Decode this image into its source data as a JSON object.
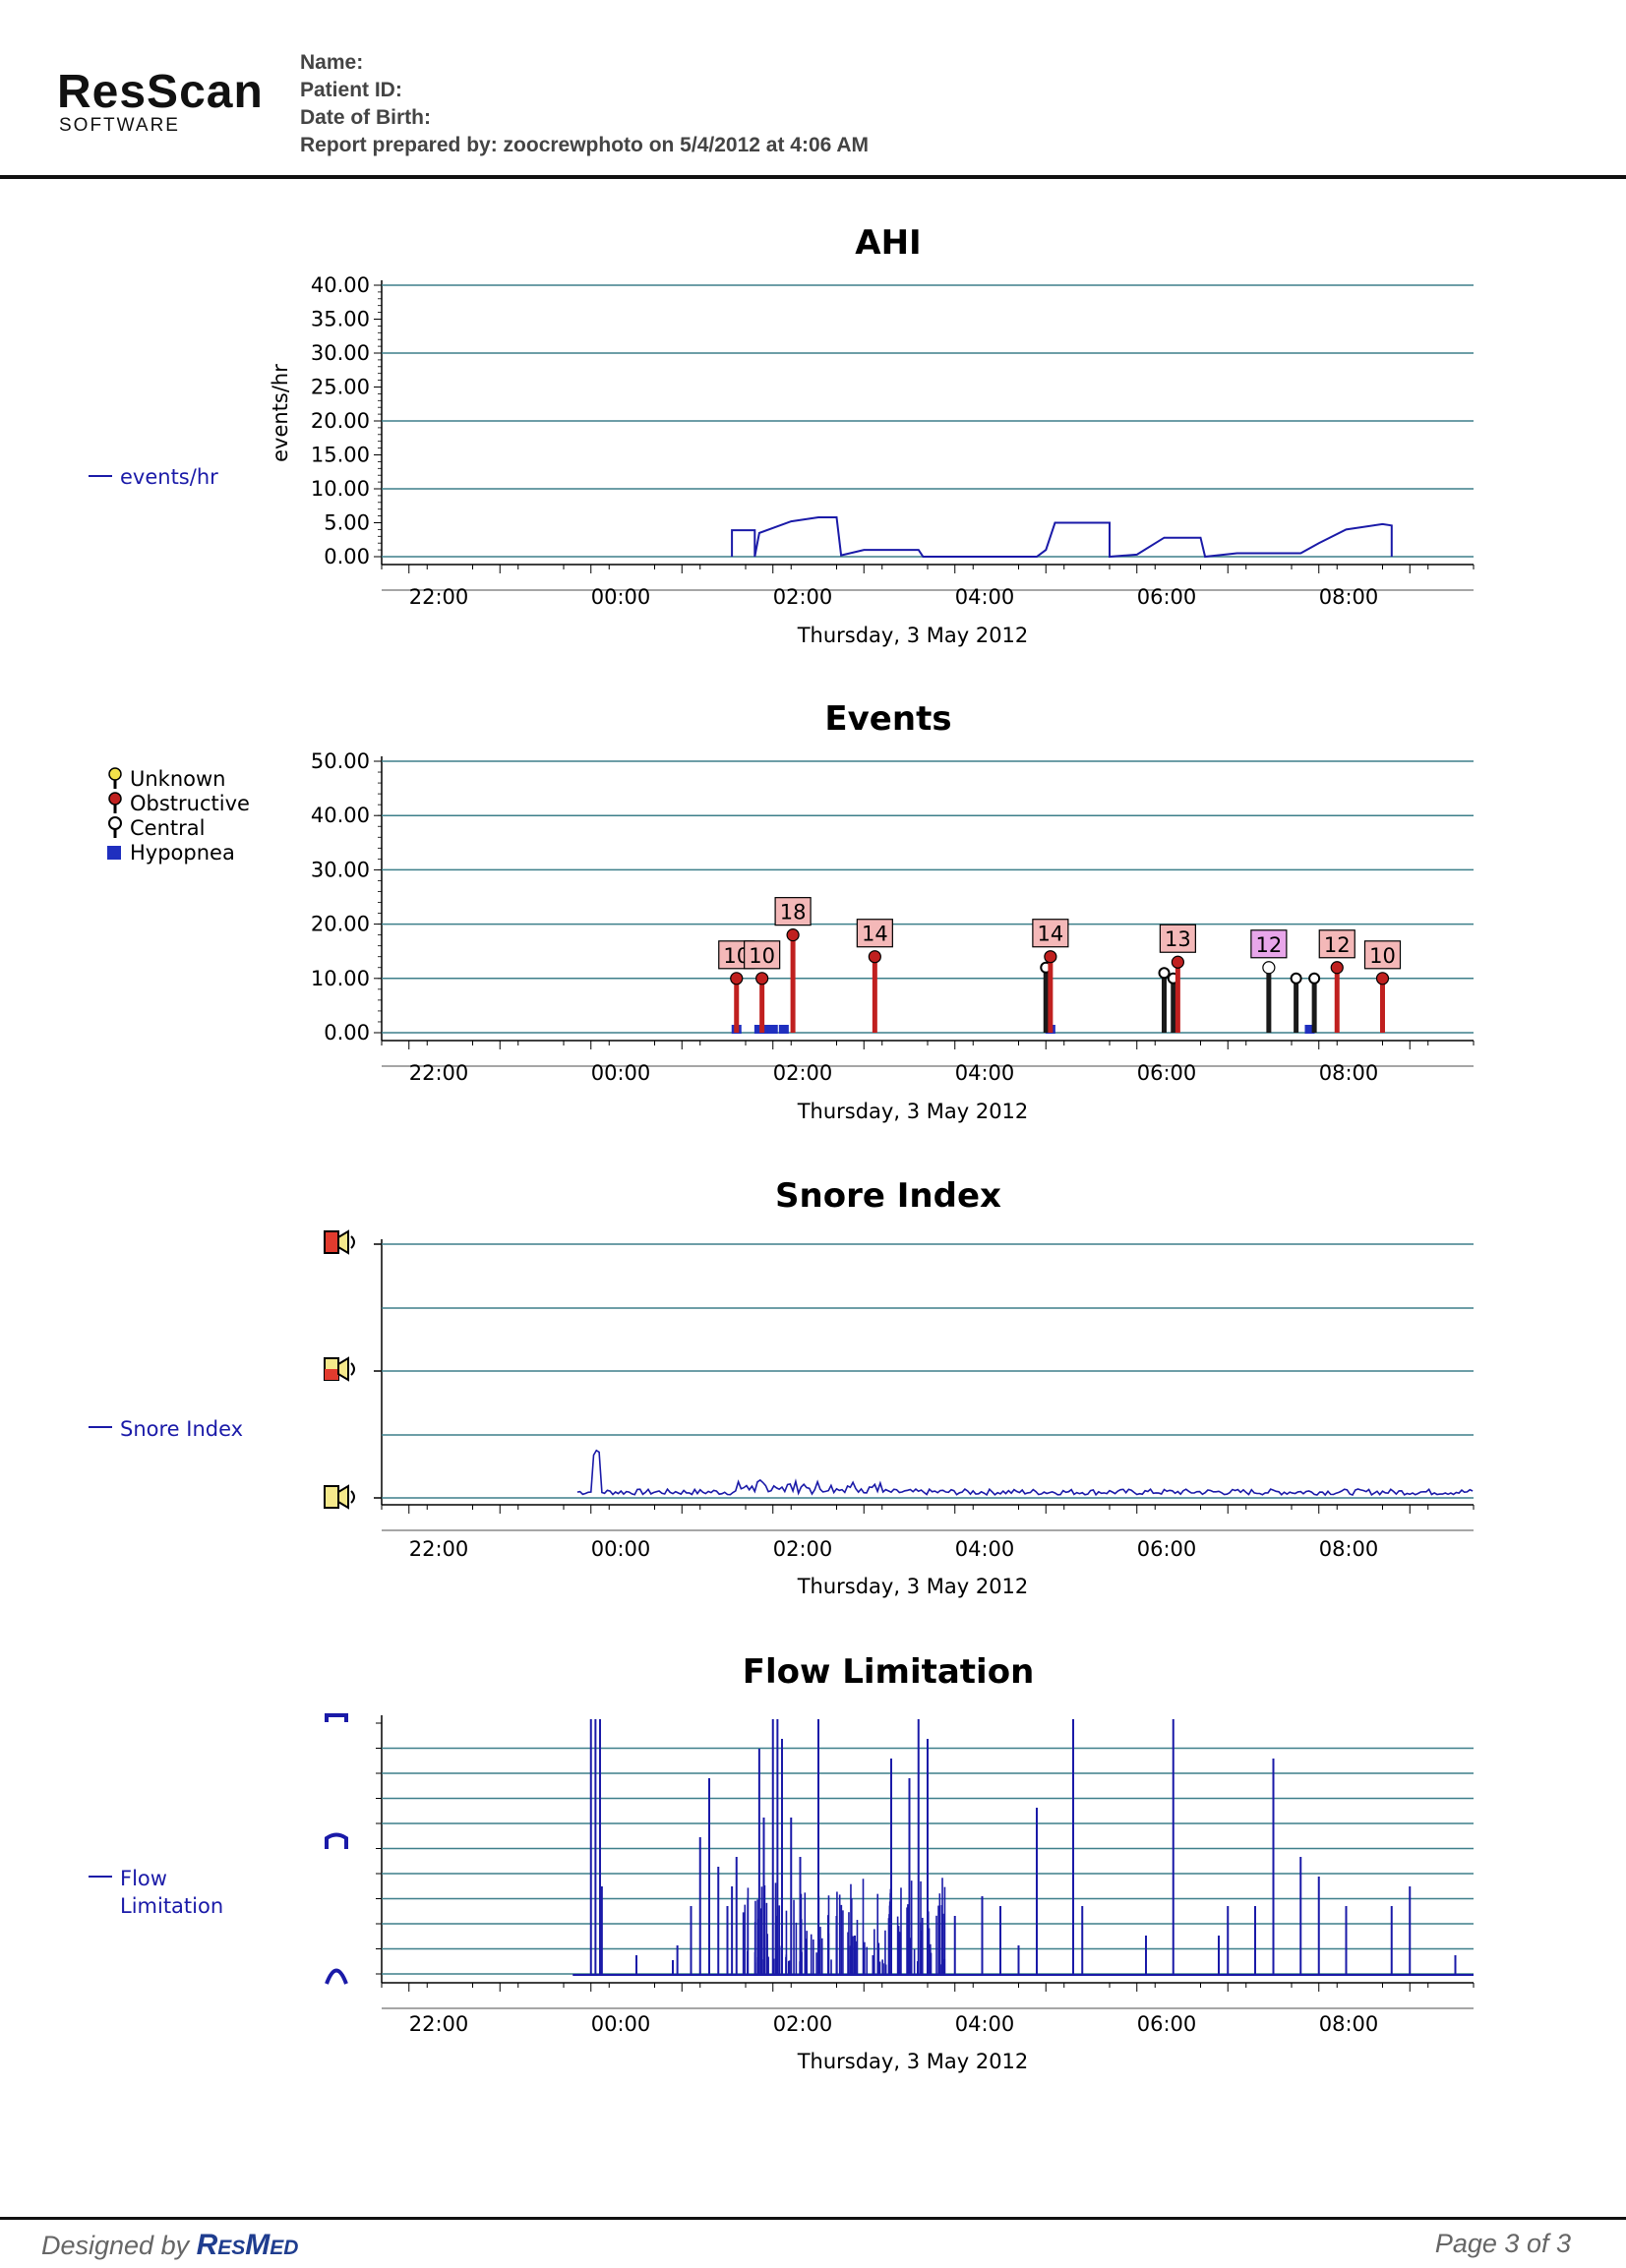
{
  "header": {
    "logo_main": "ResScan",
    "logo_sub": "SOFTWARE",
    "name_label": "Name:",
    "patient_id_label": "Patient ID:",
    "dob_label": "Date of Birth:",
    "prepared_by": "Report prepared by: zoocrewphoto on 5/4/2012 at 4:06 AM"
  },
  "footer": {
    "designed_by": "Designed by",
    "brand": "ResMed",
    "page": "Page 3 of 3"
  },
  "colors": {
    "line": "#1a1aa8",
    "grid": "#3d7f8a",
    "obstructive": "#c0201f",
    "central": "#1a1a1a",
    "hypopnea": "#1f2fbf",
    "label_pink": "#f4b8b8",
    "label_violet": "#e8a6ea"
  },
  "chart_data": [
    {
      "type": "line",
      "title": "AHI",
      "ylabel": "events/hr",
      "xlabel": "Thursday, 3 May 2012",
      "x_ticks": [
        "22:00",
        "00:00",
        "02:00",
        "04:00",
        "06:00",
        "08:00"
      ],
      "y_ticks": [
        "0.00",
        "5.00",
        "10.00",
        "15.00",
        "20.00",
        "25.00",
        "30.00",
        "35.00",
        "40.00"
      ],
      "ylim": [
        0,
        40
      ],
      "grid": true,
      "legend": [
        {
          "name": "events/hr",
          "position": "left"
        }
      ],
      "series": [
        {
          "name": "events/hr",
          "points": [
            [
              1.55,
              0
            ],
            [
              1.55,
              3.9
            ],
            [
              1.8,
              3.9
            ],
            [
              1.8,
              0
            ],
            [
              1.85,
              3.5
            ],
            [
              2.2,
              5.2
            ],
            [
              2.5,
              5.8
            ],
            [
              2.7,
              5.8
            ],
            [
              2.75,
              0.2
            ],
            [
              3.0,
              1.0
            ],
            [
              3.6,
              1.0
            ],
            [
              3.65,
              0
            ],
            [
              4.9,
              0
            ],
            [
              5.0,
              1.0
            ],
            [
              5.1,
              5.0
            ],
            [
              5.7,
              5.0
            ],
            [
              5.7,
              0
            ],
            [
              6.0,
              0.3
            ],
            [
              6.3,
              2.8
            ],
            [
              6.7,
              2.8
            ],
            [
              6.75,
              0
            ],
            [
              7.1,
              0.5
            ],
            [
              7.5,
              0.5
            ],
            [
              7.8,
              0.5
            ],
            [
              8.0,
              2.0
            ],
            [
              8.3,
              4.0
            ],
            [
              8.7,
              4.8
            ],
            [
              8.8,
              4.6
            ],
            [
              8.8,
              0
            ]
          ]
        }
      ]
    },
    {
      "type": "scatter",
      "title": "Events",
      "xlabel": "Thursday, 3 May 2012",
      "x_ticks": [
        "22:00",
        "00:00",
        "02:00",
        "04:00",
        "06:00",
        "08:00"
      ],
      "y_ticks": [
        "0.00",
        "10.00",
        "20.00",
        "30.00",
        "40.00",
        "50.00"
      ],
      "ylim": [
        0,
        50
      ],
      "grid": true,
      "legend": [
        "Unknown",
        "Obstructive",
        "Central",
        "Hypopnea"
      ],
      "events": [
        {
          "t": 1.6,
          "v": 10,
          "kind": "Obstructive",
          "label": "10"
        },
        {
          "t": 1.88,
          "v": 10,
          "kind": "Obstructive",
          "label": "10"
        },
        {
          "t": 2.22,
          "v": 18,
          "kind": "Obstructive",
          "label": "18"
        },
        {
          "t": 3.12,
          "v": 14,
          "kind": "Obstructive",
          "label": "14"
        },
        {
          "t": 5.05,
          "v": 14,
          "kind": "Obstructive",
          "label": "14"
        },
        {
          "t": 6.45,
          "v": 13,
          "kind": "Obstructive",
          "label": "13"
        },
        {
          "t": 7.45,
          "v": 12,
          "kind": "Central",
          "label": "12"
        },
        {
          "t": 8.2,
          "v": 12,
          "kind": "Obstructive",
          "label": "12"
        },
        {
          "t": 8.7,
          "v": 10,
          "kind": "Obstructive",
          "label": "10"
        }
      ]
    },
    {
      "type": "line",
      "title": "Snore Index",
      "xlabel": "Thursday, 3 May 2012",
      "x_ticks": [
        "22:00",
        "00:00",
        "02:00",
        "04:00",
        "06:00",
        "08:00"
      ],
      "grid": true,
      "legend": [
        {
          "name": "Snore Index",
          "position": "left"
        }
      ]
    },
    {
      "type": "bar",
      "title": "Flow Limitation",
      "xlabel": "Thursday, 3 May 2012",
      "x_ticks": [
        "22:00",
        "00:00",
        "02:00",
        "04:00",
        "06:00",
        "08:00"
      ],
      "grid": true,
      "legend": [
        {
          "name": "Flow\nLimitation",
          "position": "left"
        }
      ]
    }
  ]
}
